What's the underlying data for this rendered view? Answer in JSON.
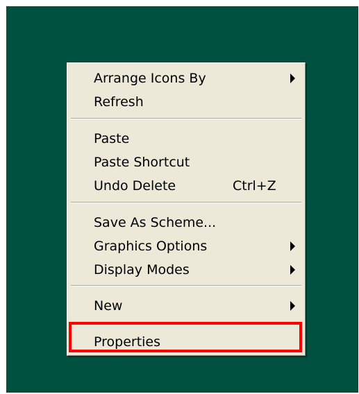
{
  "context_menu": {
    "items": [
      {
        "label": "Arrange Icons By",
        "submenu": true,
        "shortcut": ""
      },
      {
        "label": "Refresh",
        "submenu": false,
        "shortcut": ""
      },
      {
        "label": "Paste",
        "submenu": false,
        "shortcut": ""
      },
      {
        "label": "Paste Shortcut",
        "submenu": false,
        "shortcut": ""
      },
      {
        "label": "Undo Delete",
        "submenu": false,
        "shortcut": "Ctrl+Z"
      },
      {
        "label": "Save As Scheme...",
        "submenu": false,
        "shortcut": ""
      },
      {
        "label": "Graphics Options",
        "submenu": true,
        "shortcut": ""
      },
      {
        "label": "Display Modes",
        "submenu": true,
        "shortcut": ""
      },
      {
        "label": "New",
        "submenu": true,
        "shortcut": ""
      },
      {
        "label": "Properties",
        "submenu": false,
        "shortcut": "",
        "highlighted": true
      }
    ]
  },
  "colors": {
    "desktop_background": "#005040",
    "menu_background": "#ece9d8",
    "highlight_border": "#ff0000"
  }
}
